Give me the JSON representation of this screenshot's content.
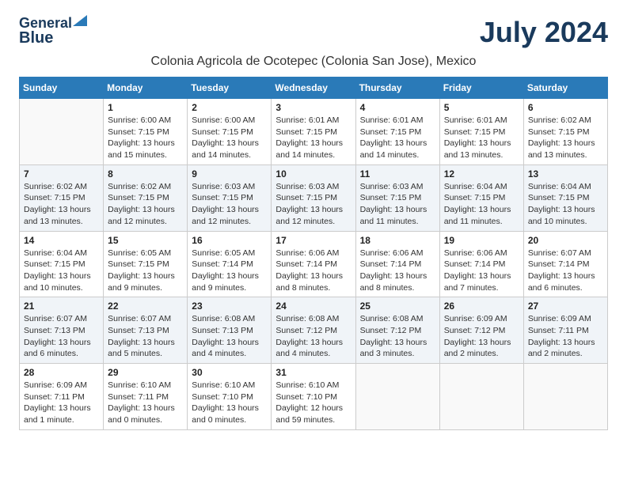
{
  "logo": {
    "line1": "General",
    "line2": "Blue"
  },
  "title": "July 2024",
  "location": "Colonia Agricola de Ocotepec (Colonia San Jose), Mexico",
  "days_of_week": [
    "Sunday",
    "Monday",
    "Tuesday",
    "Wednesday",
    "Thursday",
    "Friday",
    "Saturday"
  ],
  "weeks": [
    [
      {
        "day": "",
        "info": ""
      },
      {
        "day": "1",
        "info": "Sunrise: 6:00 AM\nSunset: 7:15 PM\nDaylight: 13 hours\nand 15 minutes."
      },
      {
        "day": "2",
        "info": "Sunrise: 6:00 AM\nSunset: 7:15 PM\nDaylight: 13 hours\nand 14 minutes."
      },
      {
        "day": "3",
        "info": "Sunrise: 6:01 AM\nSunset: 7:15 PM\nDaylight: 13 hours\nand 14 minutes."
      },
      {
        "day": "4",
        "info": "Sunrise: 6:01 AM\nSunset: 7:15 PM\nDaylight: 13 hours\nand 14 minutes."
      },
      {
        "day": "5",
        "info": "Sunrise: 6:01 AM\nSunset: 7:15 PM\nDaylight: 13 hours\nand 13 minutes."
      },
      {
        "day": "6",
        "info": "Sunrise: 6:02 AM\nSunset: 7:15 PM\nDaylight: 13 hours\nand 13 minutes."
      }
    ],
    [
      {
        "day": "7",
        "info": "Sunrise: 6:02 AM\nSunset: 7:15 PM\nDaylight: 13 hours\nand 13 minutes."
      },
      {
        "day": "8",
        "info": "Sunrise: 6:02 AM\nSunset: 7:15 PM\nDaylight: 13 hours\nand 12 minutes."
      },
      {
        "day": "9",
        "info": "Sunrise: 6:03 AM\nSunset: 7:15 PM\nDaylight: 13 hours\nand 12 minutes."
      },
      {
        "day": "10",
        "info": "Sunrise: 6:03 AM\nSunset: 7:15 PM\nDaylight: 13 hours\nand 12 minutes."
      },
      {
        "day": "11",
        "info": "Sunrise: 6:03 AM\nSunset: 7:15 PM\nDaylight: 13 hours\nand 11 minutes."
      },
      {
        "day": "12",
        "info": "Sunrise: 6:04 AM\nSunset: 7:15 PM\nDaylight: 13 hours\nand 11 minutes."
      },
      {
        "day": "13",
        "info": "Sunrise: 6:04 AM\nSunset: 7:15 PM\nDaylight: 13 hours\nand 10 minutes."
      }
    ],
    [
      {
        "day": "14",
        "info": "Sunrise: 6:04 AM\nSunset: 7:15 PM\nDaylight: 13 hours\nand 10 minutes."
      },
      {
        "day": "15",
        "info": "Sunrise: 6:05 AM\nSunset: 7:15 PM\nDaylight: 13 hours\nand 9 minutes."
      },
      {
        "day": "16",
        "info": "Sunrise: 6:05 AM\nSunset: 7:14 PM\nDaylight: 13 hours\nand 9 minutes."
      },
      {
        "day": "17",
        "info": "Sunrise: 6:06 AM\nSunset: 7:14 PM\nDaylight: 13 hours\nand 8 minutes."
      },
      {
        "day": "18",
        "info": "Sunrise: 6:06 AM\nSunset: 7:14 PM\nDaylight: 13 hours\nand 8 minutes."
      },
      {
        "day": "19",
        "info": "Sunrise: 6:06 AM\nSunset: 7:14 PM\nDaylight: 13 hours\nand 7 minutes."
      },
      {
        "day": "20",
        "info": "Sunrise: 6:07 AM\nSunset: 7:14 PM\nDaylight: 13 hours\nand 6 minutes."
      }
    ],
    [
      {
        "day": "21",
        "info": "Sunrise: 6:07 AM\nSunset: 7:13 PM\nDaylight: 13 hours\nand 6 minutes."
      },
      {
        "day": "22",
        "info": "Sunrise: 6:07 AM\nSunset: 7:13 PM\nDaylight: 13 hours\nand 5 minutes."
      },
      {
        "day": "23",
        "info": "Sunrise: 6:08 AM\nSunset: 7:13 PM\nDaylight: 13 hours\nand 4 minutes."
      },
      {
        "day": "24",
        "info": "Sunrise: 6:08 AM\nSunset: 7:12 PM\nDaylight: 13 hours\nand 4 minutes."
      },
      {
        "day": "25",
        "info": "Sunrise: 6:08 AM\nSunset: 7:12 PM\nDaylight: 13 hours\nand 3 minutes."
      },
      {
        "day": "26",
        "info": "Sunrise: 6:09 AM\nSunset: 7:12 PM\nDaylight: 13 hours\nand 2 minutes."
      },
      {
        "day": "27",
        "info": "Sunrise: 6:09 AM\nSunset: 7:11 PM\nDaylight: 13 hours\nand 2 minutes."
      }
    ],
    [
      {
        "day": "28",
        "info": "Sunrise: 6:09 AM\nSunset: 7:11 PM\nDaylight: 13 hours\nand 1 minute."
      },
      {
        "day": "29",
        "info": "Sunrise: 6:10 AM\nSunset: 7:11 PM\nDaylight: 13 hours\nand 0 minutes."
      },
      {
        "day": "30",
        "info": "Sunrise: 6:10 AM\nSunset: 7:10 PM\nDaylight: 13 hours\nand 0 minutes."
      },
      {
        "day": "31",
        "info": "Sunrise: 6:10 AM\nSunset: 7:10 PM\nDaylight: 12 hours\nand 59 minutes."
      },
      {
        "day": "",
        "info": ""
      },
      {
        "day": "",
        "info": ""
      },
      {
        "day": "",
        "info": ""
      }
    ]
  ]
}
